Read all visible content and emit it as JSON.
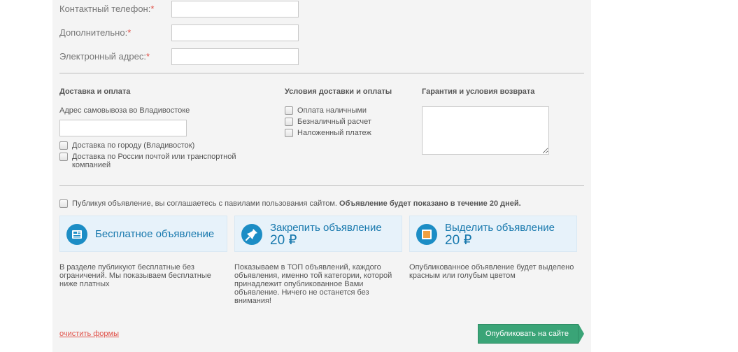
{
  "contact": {
    "phone_label": "Контактный телефон:",
    "extra_label": "Дополнительно:",
    "email_label": "Электронный адрес:",
    "required_mark": "*"
  },
  "delivery": {
    "title": "Доставка и оплата",
    "pickup_label": "Адрес самовывоза во Владивостоке",
    "city_delivery": "Доставка по городу (Владивосток)",
    "russia_delivery_line1": "Доставка по России почтой или транспортной",
    "russia_delivery_line2": "компанией"
  },
  "payment": {
    "title": "Условия доставки и оплаты",
    "options": [
      "Оплата наличными",
      "Безналичный расчет",
      "Наложенный платеж"
    ]
  },
  "warranty": {
    "title": "Гарантия и условия возврата"
  },
  "agreement": {
    "text": "Публикуя объявление, вы соглашаетесь с павилами пользования сайтом.",
    "bold": "Объявление будет показано в течение 20 дней."
  },
  "cards": [
    {
      "title": "Бесплатное объявление",
      "price": "",
      "desc": [
        "В разделе публикуют бесплатные без",
        "ограничений. Мы показываем бесплатные",
        "ниже платных"
      ]
    },
    {
      "title": "Закрепить объявление",
      "price": "20 ₽",
      "desc": [
        "Показываем в ТОП объявлений, каждого",
        "объявления, именно той категории, которой",
        "принадлежит опубликованное Вами",
        "объявление. Ничего не останется без",
        "внимания!"
      ]
    },
    {
      "title": "Выделить объявление",
      "price": "20 ₽",
      "desc": [
        "Опубликованное объявление будет выделено",
        "красным или голубым цветом"
      ]
    }
  ],
  "actions": {
    "clear": "очистить формы",
    "publish": "Опубликовать на сайте"
  },
  "colors": {
    "accent_blue": "#1778ad",
    "card_bg": "#e7f2fa",
    "publish_green": "#3aa477",
    "required_red": "#e0524a"
  }
}
